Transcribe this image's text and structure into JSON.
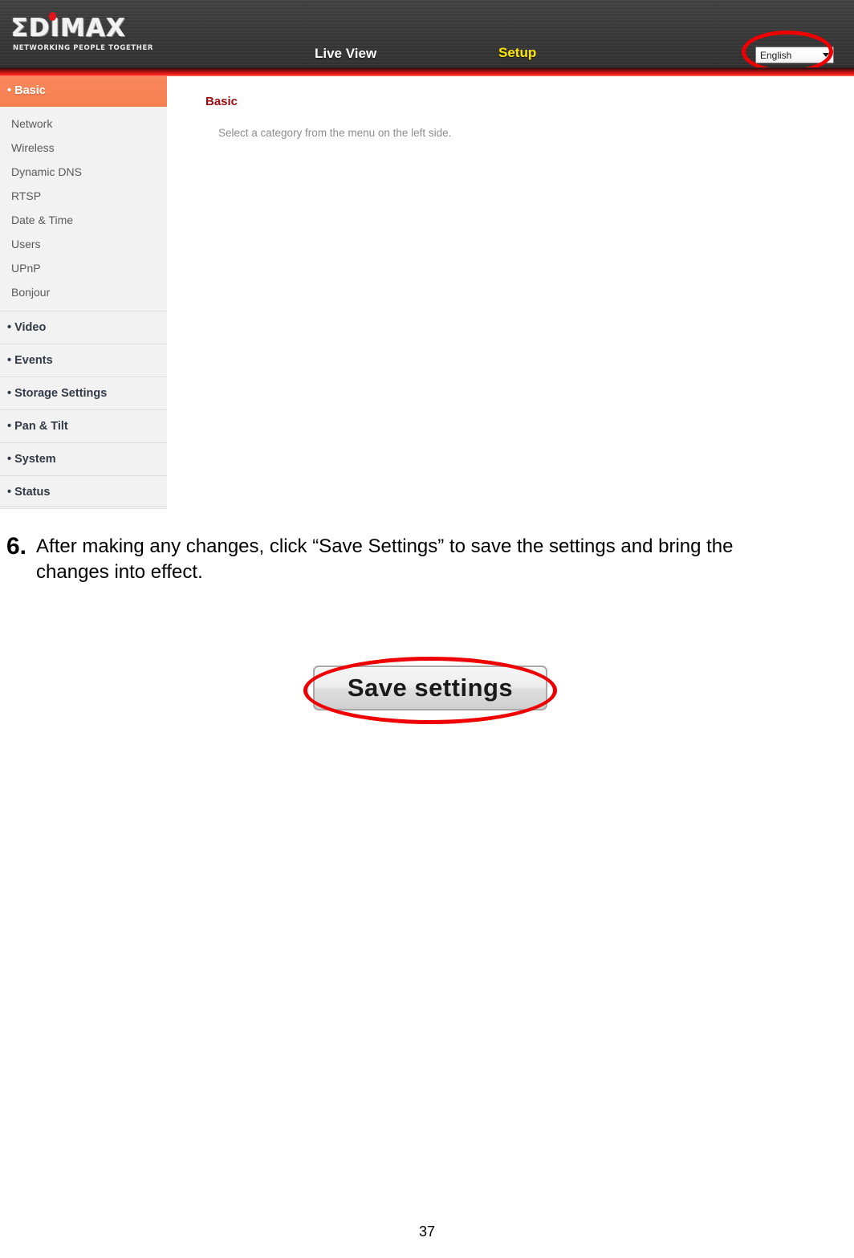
{
  "screenshot": {
    "header": {
      "logo_text": "ΣDIMAX",
      "logo_tagline": "NETWORKING PEOPLE TOGETHER",
      "nav": {
        "live_view": "Live View",
        "setup": "Setup"
      },
      "language_select": {
        "value": "English",
        "options": [
          "English"
        ]
      }
    },
    "sidebar": {
      "active_section": {
        "label": "Basic",
        "bullet": "•",
        "items": [
          {
            "label": "Network"
          },
          {
            "label": "Wireless"
          },
          {
            "label": "Dynamic DNS"
          },
          {
            "label": "RTSP"
          },
          {
            "label": "Date & Time"
          },
          {
            "label": "Users"
          },
          {
            "label": "UPnP"
          },
          {
            "label": "Bonjour"
          }
        ]
      },
      "sections": [
        {
          "label": "Video",
          "bullet": "•"
        },
        {
          "label": "Events",
          "bullet": "•"
        },
        {
          "label": "Storage Settings",
          "bullet": "•"
        },
        {
          "label": "Pan & Tilt",
          "bullet": "•"
        },
        {
          "label": "System",
          "bullet": "•"
        },
        {
          "label": "Status",
          "bullet": "•"
        }
      ]
    },
    "content": {
      "title": "Basic",
      "description": "Select a category from the menu on the left side."
    },
    "colors": {
      "active_orange": "#F57F4F",
      "title_red": "#9E0B0F",
      "setup_yellow": "#FFE800",
      "highlight_red": "#EE0000",
      "header_dark": "#3B3B3B"
    }
  },
  "instruction": {
    "number": "6.",
    "text": "After making any changes, click “Save Settings” to save the settings and bring the changes into effect."
  },
  "save_button": {
    "label": "Save settings"
  },
  "footer": {
    "page_number": "37"
  }
}
